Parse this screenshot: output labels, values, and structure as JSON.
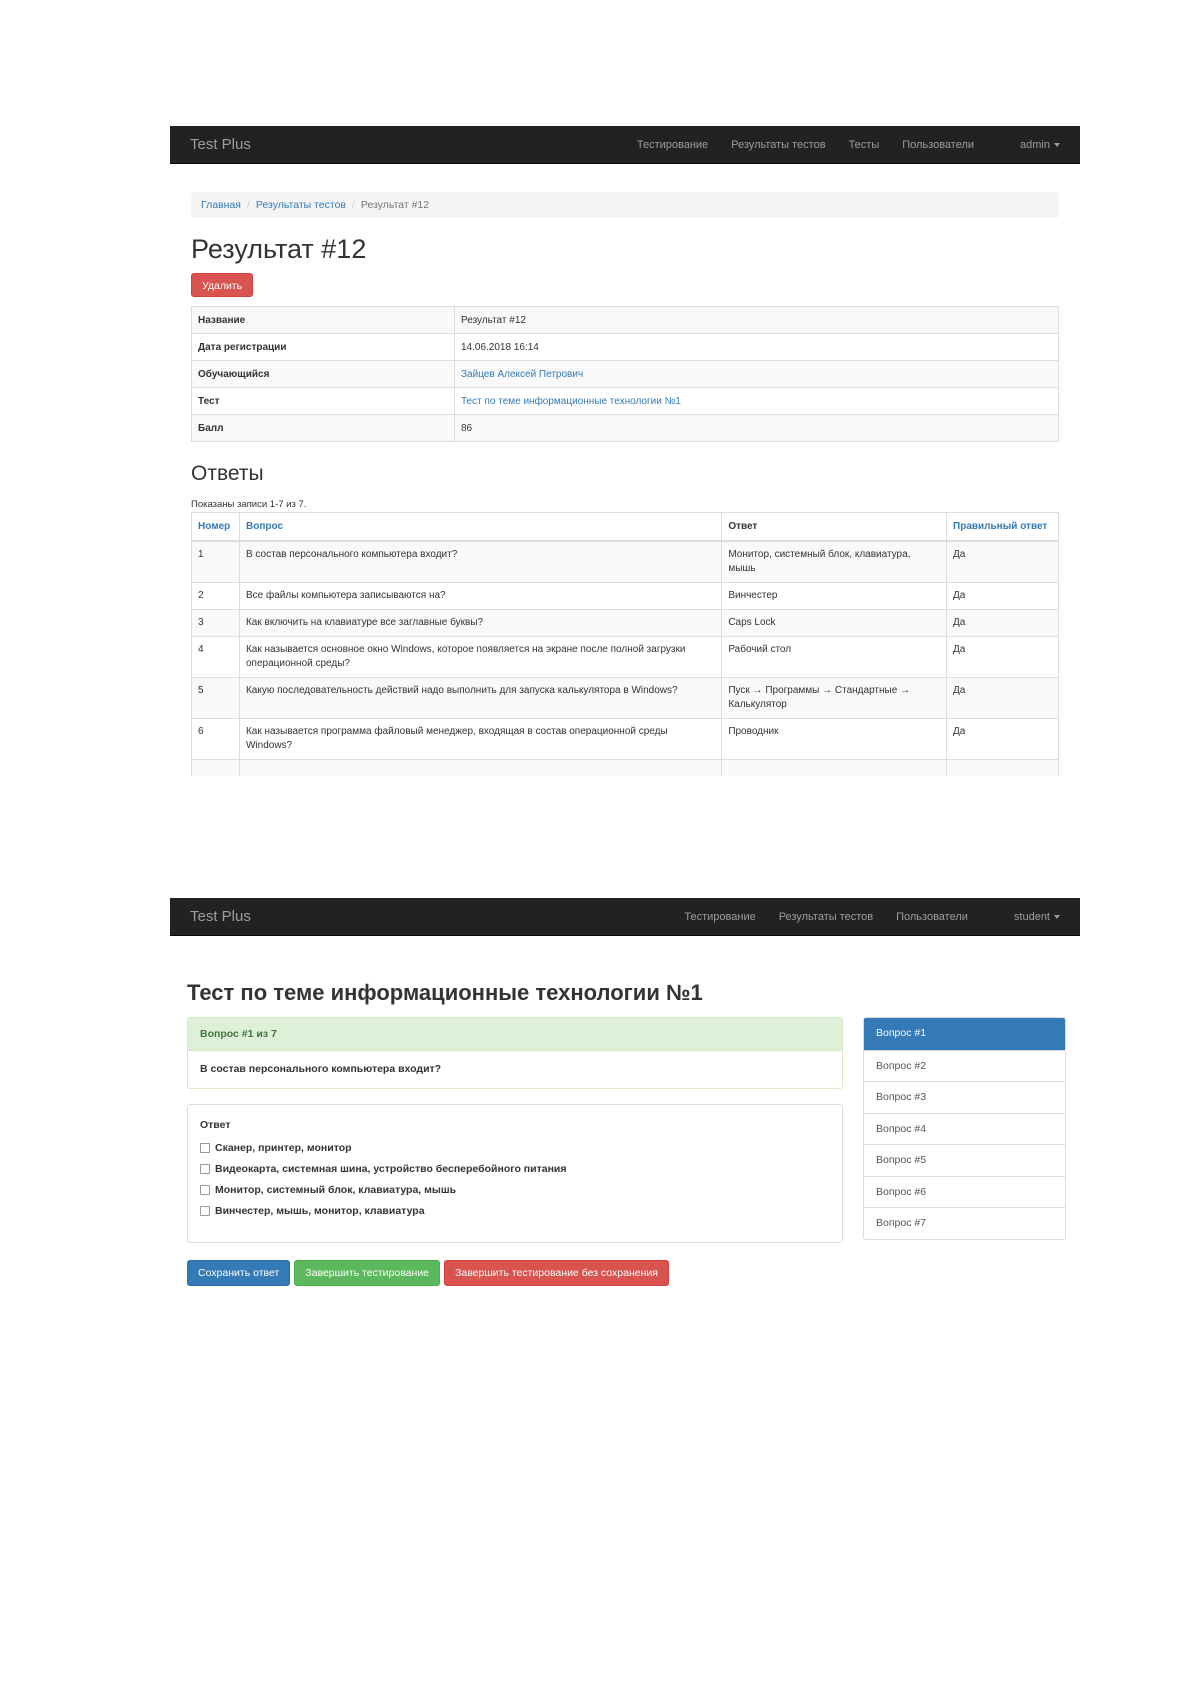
{
  "result_page": {
    "navbar": {
      "brand": "Test Plus",
      "items": [
        "Тестирование",
        "Результаты тестов",
        "Тесты",
        "Пользователи"
      ],
      "user": "admin"
    },
    "breadcrumb": {
      "home": "Главная",
      "results": "Результаты тестов",
      "current": "Результат #12"
    },
    "title": "Результат #12",
    "delete_label": "Удалить",
    "details": {
      "name_label": "Название",
      "name_value": "Результат #12",
      "date_label": "Дата регистрации",
      "date_value": "14.06.2018 16:14",
      "student_label": "Обучающийся",
      "student_value": "Зайцев Алексей Петрович",
      "test_label": "Тест",
      "test_value": "Тест по теме информационные технологии №1",
      "score_label": "Балл",
      "score_value": "86"
    },
    "answers_title": "Ответы",
    "summary": "Показаны записи 1-7 из 7.",
    "columns": {
      "number": "Номер",
      "question": "Вопрос",
      "answer": "Ответ",
      "correct": "Правильный ответ"
    },
    "rows": [
      {
        "num": "1",
        "question": "В состав персонального компьютера входит?",
        "answer": "Монитор, системный блок, клавиатура, мышь",
        "correct": "Да"
      },
      {
        "num": "2",
        "question": "Все файлы компьютера записываются на?",
        "answer": "Винчестер",
        "correct": "Да"
      },
      {
        "num": "3",
        "question": "Как включить на клавиатуре все заглавные буквы?",
        "answer": "Caps Lock",
        "correct": "Да"
      },
      {
        "num": "4",
        "question": "Как называется основное окно Windows, которое появляется на экране после полной загрузки операционной среды?",
        "answer": "Рабочий стол",
        "correct": "Да"
      },
      {
        "num": "5",
        "question": "Какую последовательность действий надо выполнить для запуска калькулятора в Windows?",
        "answer": "Пуск → Программы → Стандартные → Калькулятор",
        "correct": "Да"
      },
      {
        "num": "6",
        "question": "Как называется программа файловый менеджер, входящая в состав операционной среды Windows?",
        "answer": "Проводник",
        "correct": "Да"
      }
    ]
  },
  "test_page": {
    "navbar": {
      "brand": "Test Plus",
      "items": [
        "Тестирование",
        "Результаты тестов",
        "Пользователи"
      ],
      "user": "student"
    },
    "title": "Тест по теме информационные технологии №1",
    "question_header": "Вопрос #1 из 7",
    "question_text": "В состав персонального компьютера входит?",
    "answer_title": "Ответ",
    "options": [
      "Сканер, принтер, монитор",
      "Видеокарта, системная шина, устройство бесперебойного питания",
      "Монитор, системный блок, клавиатура, мышь",
      "Винчестер, мышь, монитор, клавиатура"
    ],
    "buttons": {
      "save": "Сохранить ответ",
      "finish": "Завершить тестирование",
      "finish_nosave": "Завершить тестирование без сохранения"
    },
    "question_nav": [
      "Вопрос #1",
      "Вопрос #2",
      "Вопрос #3",
      "Вопрос #4",
      "Вопрос #5",
      "Вопрос #6",
      "Вопрос #7"
    ]
  }
}
